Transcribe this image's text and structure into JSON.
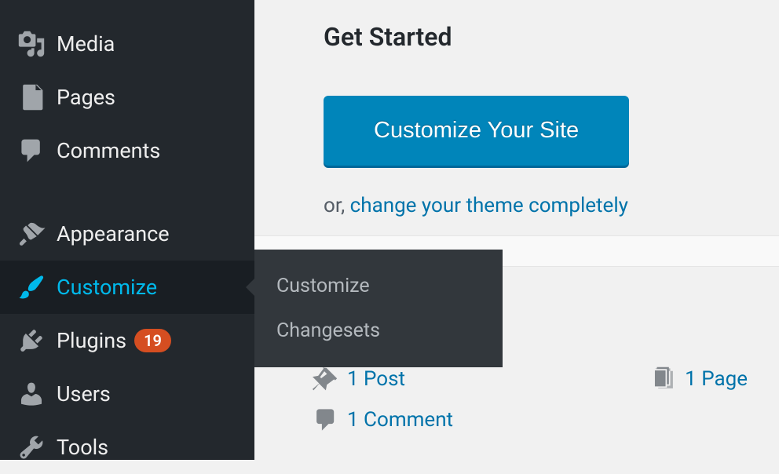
{
  "sidebar": {
    "items": [
      {
        "label": "Media"
      },
      {
        "label": "Pages"
      },
      {
        "label": "Comments"
      },
      {
        "label": "Appearance"
      },
      {
        "label": "Customize"
      },
      {
        "label": "Plugins",
        "badge": "19"
      },
      {
        "label": "Users"
      },
      {
        "label": "Tools"
      }
    ]
  },
  "submenu": {
    "items": [
      {
        "label": "Customize"
      },
      {
        "label": "Changesets"
      }
    ]
  },
  "main": {
    "heading": "Get Started",
    "button": "Customize Your Site",
    "or_prefix": "or, ",
    "or_link": "change your theme completely"
  },
  "stats": {
    "posts": "1 Post",
    "comments": "1 Comment",
    "pages": "1 Page"
  }
}
